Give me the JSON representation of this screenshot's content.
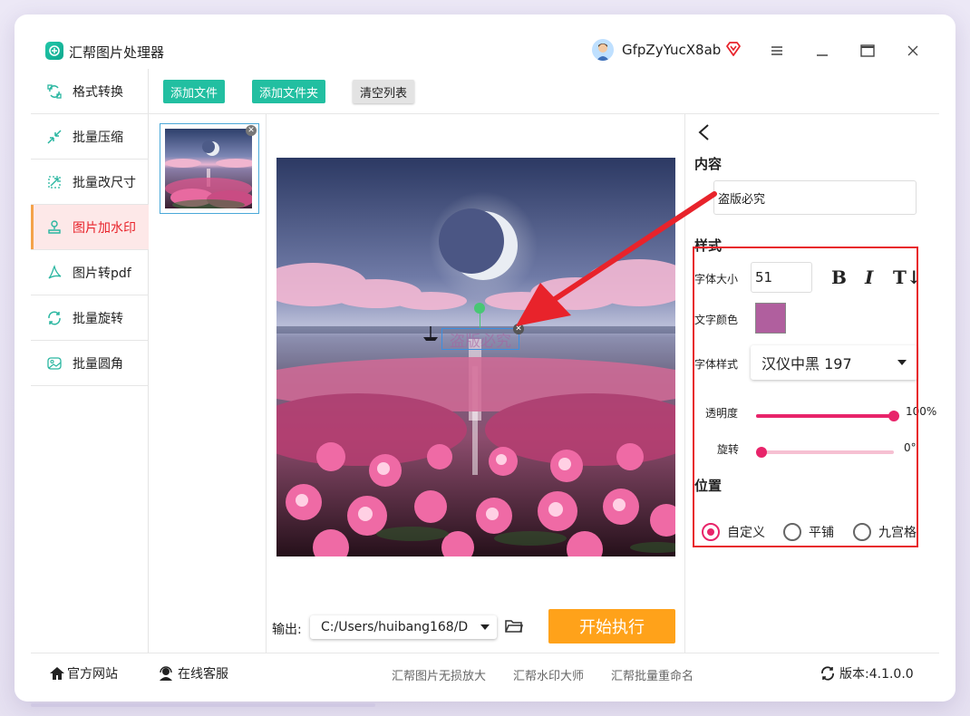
{
  "app": {
    "title": "汇帮图片处理器",
    "username": "GfpZyYucX8ab"
  },
  "sidebar": {
    "items": [
      {
        "label": "格式转换",
        "icon": "convert-icon"
      },
      {
        "label": "批量压缩",
        "icon": "compress-icon"
      },
      {
        "label": "批量改尺寸",
        "icon": "resize-icon"
      },
      {
        "label": "图片加水印",
        "icon": "watermark-icon",
        "active": true
      },
      {
        "label": "图片转pdf",
        "icon": "pdf-icon"
      },
      {
        "label": "批量旋转",
        "icon": "rotate-icon"
      },
      {
        "label": "批量圆角",
        "icon": "rounded-corner-icon"
      }
    ]
  },
  "toolbar": {
    "add_file": "添加文件",
    "add_folder": "添加文件夹",
    "clear_list": "清空列表"
  },
  "preview": {
    "watermark_text": "盗版必究"
  },
  "output": {
    "label": "输出:",
    "path": "C:/Users/huibang168/D",
    "start": "开始执行"
  },
  "panel": {
    "content_title": "内容",
    "content_value": "盗版必究",
    "style_title": "样式",
    "font_size_label": "字体大小",
    "font_size_value": "51",
    "bold": "B",
    "italic": "I",
    "vertical_text": "T↓",
    "text_color_label": "文字颜色",
    "text_color": "#b05f9e",
    "font_style_label": "字体样式",
    "font_style_value": "汉仪中黑 197",
    "opacity_label": "透明度",
    "opacity_value": "100%",
    "opacity_fraction": 1.0,
    "rotate_label": "旋转",
    "rotate_value": "0°",
    "rotate_fraction": 0.0,
    "position_title": "位置",
    "positions": [
      {
        "label": "自定义",
        "selected": true
      },
      {
        "label": "平铺",
        "selected": false
      },
      {
        "label": "九宫格",
        "selected": false
      }
    ]
  },
  "footer": {
    "website": "官方网站",
    "support": "在线客服",
    "links": [
      "汇帮图片无损放大",
      "汇帮水印大师",
      "汇帮批量重命名"
    ],
    "version": "版本:4.1.0.0"
  },
  "colors": {
    "accent_green": "#22bfa1",
    "accent_orange": "#ffa21a",
    "accent_pink": "#e8246a",
    "annotation_red": "#e8232b"
  }
}
